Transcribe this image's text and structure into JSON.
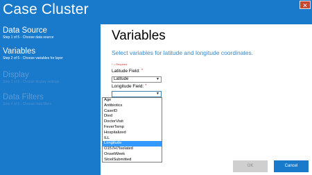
{
  "window": {
    "title": "Case Cluster",
    "close_glyph": "✕"
  },
  "sidebar": {
    "steps": [
      {
        "title": "Data Source",
        "subtitle": "Step 1 of 5 - Choose data source"
      },
      {
        "title": "Variables",
        "subtitle": "Step 2 of 5 - Choose variables for layer"
      },
      {
        "title": "Display",
        "subtitle": "Step 3 of 5 - Choose display settings"
      },
      {
        "title": "Data Filters",
        "subtitle": "Step 4 of 5 - Choose data filters"
      }
    ]
  },
  "main": {
    "heading": "Variables",
    "subheading": "Select variables for latitude and longitude coordinates.",
    "required_note": "* = Required",
    "latitude": {
      "label": "Latitude Field:",
      "required_mark": "*",
      "value": "Latitude"
    },
    "longitude": {
      "label": "Longitude Field:",
      "required_mark": "*",
      "value": ""
    },
    "dropdown": {
      "options": [
        "Age",
        "Antibiotics",
        "CaseID",
        "Died",
        "DoctorVisit",
        "FeverTemp",
        "Hospitalized",
        "ILL",
        "Longitude",
        "O157H7Isolated",
        "OnsetWeek",
        "StoolSubmitted"
      ],
      "highlighted": "Longitude"
    }
  },
  "footer": {
    "ok_label": "OK",
    "cancel_label": "Cancel"
  },
  "colors": {
    "accent": "#1979ca",
    "selected": "#3399ff",
    "required": "#cc3333"
  },
  "icons": {
    "close": "close-icon",
    "dropdown_arrow": "chevron-down-icon"
  }
}
